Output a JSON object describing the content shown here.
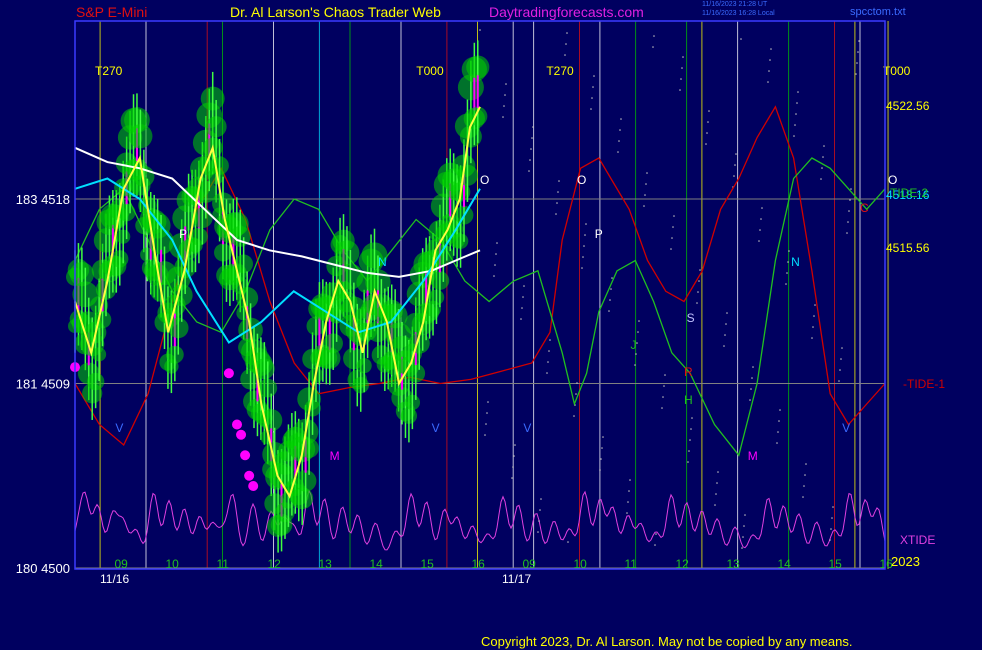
{
  "header": {
    "instrument": "S&P E-Mini",
    "site_title": "Dr. Al Larson's Chaos Trader Web",
    "site_url": "Daytradingforecasts.com",
    "timestamp_1": "11/16/2023 21:28 UT",
    "timestamp_2": "11/16/2023 16:28 Local",
    "file": "spcctom.txt"
  },
  "footer": {
    "copyright": "Copyright 2023, Dr. Al Larson. May not be copied by any means."
  },
  "colors": {
    "background": "#000060",
    "frame": "#3a3aff",
    "price_candles": "#00d000",
    "price_line": "#ffff40",
    "ma_cyan": "#00e0ff",
    "ma_white": "#ffffff",
    "tide_1": "#d00000",
    "tide_2": "#20c020",
    "xtide": "#e040e0",
    "markers": "#ff00ff"
  },
  "chart_data": {
    "type": "line",
    "title": "S&P E-Mini",
    "y_left_ticks": [
      {
        "label": "183  4518",
        "value": 4518
      },
      {
        "label": "181  4509",
        "value": 4509
      },
      {
        "label": "180  4500",
        "value": 4500
      }
    ],
    "y_right_ticks": [
      "4522.56",
      "4518.16",
      "4515.56"
    ],
    "series_labels": {
      "tide_2": "TIDE-2",
      "tide_1": "-TIDE-1",
      "xtide": "XTIDE"
    },
    "x_hours": [
      "09",
      "10",
      "11",
      "12",
      "13",
      "14",
      "15",
      "16",
      "09",
      "10",
      "11",
      "12",
      "13",
      "14",
      "15",
      "16"
    ],
    "x_dates": [
      "11/16",
      "11/17"
    ],
    "year": "2023",
    "top_markers": [
      "T270",
      "T000",
      "T270",
      "T000"
    ],
    "price_path": [
      [
        0.0,
        4513.0
      ],
      [
        0.04,
        4510.5
      ],
      [
        0.08,
        4514.0
      ],
      [
        0.12,
        4518.5
      ],
      [
        0.16,
        4520.0
      ],
      [
        0.2,
        4515.0
      ],
      [
        0.23,
        4511.5
      ],
      [
        0.27,
        4514.5
      ],
      [
        0.31,
        4519.0
      ],
      [
        0.34,
        4520.5
      ],
      [
        0.37,
        4517.0
      ],
      [
        0.4,
        4514.5
      ],
      [
        0.43,
        4512.0
      ],
      [
        0.46,
        4508.0
      ],
      [
        0.5,
        4504.5
      ],
      [
        0.53,
        4503.5
      ],
      [
        0.56,
        4505.5
      ],
      [
        0.59,
        4509.0
      ],
      [
        0.62,
        4512.0
      ],
      [
        0.65,
        4514.0
      ],
      [
        0.68,
        4513.0
      ],
      [
        0.71,
        4510.5
      ],
      [
        0.74,
        4513.5
      ],
      [
        0.77,
        4512.0
      ],
      [
        0.8,
        4509.0
      ],
      [
        0.83,
        4510.0
      ],
      [
        0.86,
        4512.0
      ],
      [
        0.89,
        4515.5
      ],
      [
        0.92,
        4516.5
      ],
      [
        0.95,
        4518.0
      ],
      [
        0.975,
        4521.5
      ],
      [
        1.0,
        4522.5
      ]
    ],
    "cyan_ma": [
      [
        0.0,
        4518.5
      ],
      [
        0.08,
        4519.0
      ],
      [
        0.16,
        4518.0
      ],
      [
        0.24,
        4516.0
      ],
      [
        0.3,
        4513.5
      ],
      [
        0.38,
        4511.0
      ],
      [
        0.46,
        4512.0
      ],
      [
        0.54,
        4513.5
      ],
      [
        0.62,
        4512.5
      ],
      [
        0.7,
        4511.5
      ],
      [
        0.78,
        4512.0
      ],
      [
        0.86,
        4514.0
      ],
      [
        0.94,
        4516.5
      ],
      [
        1.0,
        4518.5
      ]
    ],
    "white_ma": [
      [
        0.0,
        4520.5
      ],
      [
        0.08,
        4519.8
      ],
      [
        0.16,
        4519.5
      ],
      [
        0.24,
        4519.0
      ],
      [
        0.32,
        4517.5
      ],
      [
        0.4,
        4516.0
      ],
      [
        0.48,
        4515.5
      ],
      [
        0.56,
        4515.2
      ],
      [
        0.64,
        4514.8
      ],
      [
        0.72,
        4514.4
      ],
      [
        0.8,
        4514.2
      ],
      [
        0.88,
        4514.5
      ],
      [
        0.94,
        4515.0
      ],
      [
        1.0,
        4515.5
      ]
    ],
    "tide1": [
      [
        0.0,
        4509.0
      ],
      [
        0.04,
        4507.0
      ],
      [
        0.08,
        4506.0
      ],
      [
        0.12,
        4508.5
      ],
      [
        0.16,
        4513.0
      ],
      [
        0.2,
        4517.5
      ],
      [
        0.24,
        4519.5
      ],
      [
        0.28,
        4517.0
      ],
      [
        0.32,
        4513.0
      ],
      [
        0.36,
        4510.0
      ],
      [
        0.4,
        4508.5
      ],
      [
        0.45,
        4508.8
      ],
      [
        0.5,
        4509.0
      ],
      [
        0.55,
        4509.3
      ],
      [
        0.6,
        4509.0
      ],
      [
        0.65,
        4509.2
      ],
      [
        0.7,
        4509.6
      ],
      [
        0.75,
        4510.0
      ],
      [
        0.78,
        4511.5
      ],
      [
        0.8,
        4516.0
      ],
      [
        0.83,
        4519.5
      ],
      [
        0.86,
        4520.0
      ],
      [
        0.88,
        4519.0
      ],
      [
        0.91,
        4517.5
      ],
      [
        0.94,
        4515.0
      ],
      [
        0.97,
        4513.5
      ],
      [
        1.0,
        4513.0
      ],
      [
        1.03,
        4514.5
      ],
      [
        1.06,
        4517.5
      ],
      [
        1.09,
        4519.0
      ],
      [
        1.12,
        4521.0
      ],
      [
        1.15,
        4522.5
      ],
      [
        1.18,
        4520.0
      ],
      [
        1.21,
        4514.5
      ],
      [
        1.24,
        4508.5
      ],
      [
        1.27,
        4507.0
      ],
      [
        1.3,
        4508.0
      ],
      [
        1.33,
        4509.0
      ]
    ],
    "tide2": [
      [
        0.0,
        4515.0
      ],
      [
        0.04,
        4517.5
      ],
      [
        0.08,
        4518.5
      ],
      [
        0.12,
        4516.0
      ],
      [
        0.16,
        4513.5
      ],
      [
        0.2,
        4512.0
      ],
      [
        0.24,
        4511.5
      ],
      [
        0.28,
        4513.5
      ],
      [
        0.32,
        4516.5
      ],
      [
        0.36,
        4518.0
      ],
      [
        0.4,
        4517.5
      ],
      [
        0.44,
        4515.5
      ],
      [
        0.48,
        4514.0
      ],
      [
        0.52,
        4515.5
      ],
      [
        0.56,
        4517.0
      ],
      [
        0.6,
        4516.0
      ],
      [
        0.64,
        4514.0
      ],
      [
        0.68,
        4513.0
      ],
      [
        0.72,
        4514.0
      ],
      [
        0.76,
        4514.5
      ],
      [
        0.8,
        4510.5
      ],
      [
        0.82,
        4508.0
      ],
      [
        0.84,
        4509.5
      ],
      [
        0.86,
        4512.5
      ],
      [
        0.89,
        4514.5
      ],
      [
        0.92,
        4515.0
      ],
      [
        0.95,
        4513.0
      ],
      [
        0.98,
        4510.5
      ],
      [
        1.01,
        4509.5
      ],
      [
        1.05,
        4507.0
      ],
      [
        1.09,
        4505.5
      ],
      [
        1.12,
        4509.0
      ],
      [
        1.15,
        4515.0
      ],
      [
        1.18,
        4519.0
      ],
      [
        1.21,
        4520.0
      ],
      [
        1.24,
        4519.5
      ],
      [
        1.27,
        4518.5
      ],
      [
        1.3,
        4517.5
      ],
      [
        1.33,
        4518.5
      ]
    ],
    "xtide_peak_hours": [
      0.05,
      0.2,
      0.45,
      0.75,
      0.95,
      1.2,
      1.55,
      1.85,
      2.15,
      2.45,
      2.7,
      2.9,
      3.1,
      3.5,
      3.85,
      4.1,
      4.3,
      4.6,
      4.9,
      5.25,
      5.55,
      5.9,
      6.3,
      6.6,
      6.9,
      7.25,
      7.5,
      7.8,
      8.1,
      8.4,
      8.7,
      9.05,
      9.4,
      9.7,
      10.0,
      10.3,
      10.55,
      10.85,
      11.1,
      11.4,
      11.7,
      12.0,
      12.3,
      12.6,
      12.95,
      13.3,
      13.6,
      13.9,
      14.2,
      14.55,
      14.9,
      15.2,
      15.5,
      15.75
    ]
  }
}
